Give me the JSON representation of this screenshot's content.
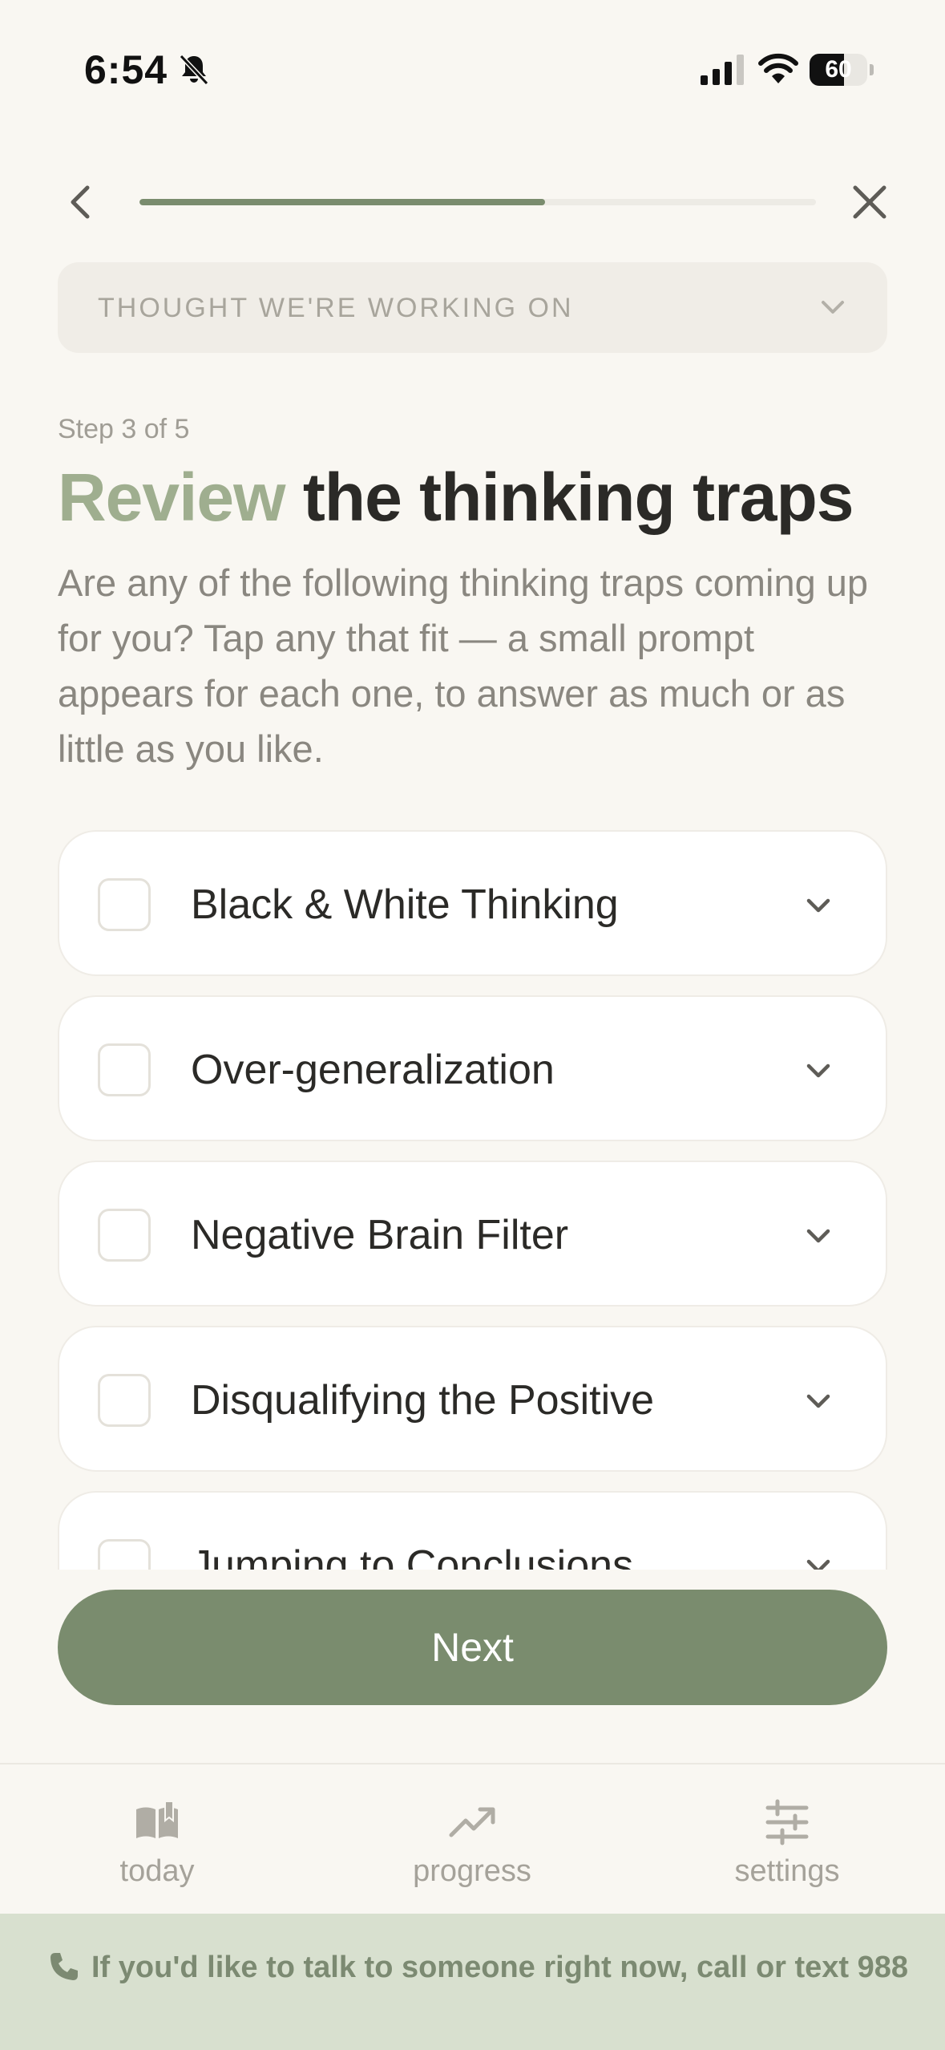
{
  "status_bar": {
    "time": "6:54",
    "battery_level": "60",
    "battery_fraction": 0.6,
    "icons": [
      "bell-slash-icon",
      "signal-icon",
      "wifi-icon",
      "battery-icon"
    ]
  },
  "nav": {
    "back_icon": "chevron-left-icon",
    "close_icon": "close-icon",
    "progress_fraction": 0.6
  },
  "thought": {
    "label": "THOUGHT WE'RE WORKING ON",
    "icon": "chevron-down-icon"
  },
  "step": {
    "label": "Step 3 of 5",
    "title_accent": "Review",
    "title_rest": " the thinking traps",
    "intro": "Are any of the following thinking traps coming up for you? Tap any that fit — a small prompt appears for each one, to answer as much or as little as you like."
  },
  "traps": [
    {
      "label": "Black & White Thinking",
      "checked": false
    },
    {
      "label": "Over-generalization",
      "checked": false
    },
    {
      "label": "Negative Brain Filter",
      "checked": false
    },
    {
      "label": "Disqualifying the Positive",
      "checked": false
    },
    {
      "label": "Jumping to Conclusions",
      "checked": false
    }
  ],
  "next_label": "Next",
  "tabs": [
    {
      "label": "today",
      "icon": "book-icon"
    },
    {
      "label": "progress",
      "icon": "trending-up-icon"
    },
    {
      "label": "settings",
      "icon": "sliders-icon"
    }
  ],
  "crisis": {
    "text": "If you'd like to talk to someone right now, call or text 988",
    "icon": "phone-icon"
  },
  "colors": {
    "accent": "#7a8c6e",
    "accent_light": "#9fae8f",
    "background": "#f9f7f2",
    "banner": "#d8e0cf"
  }
}
